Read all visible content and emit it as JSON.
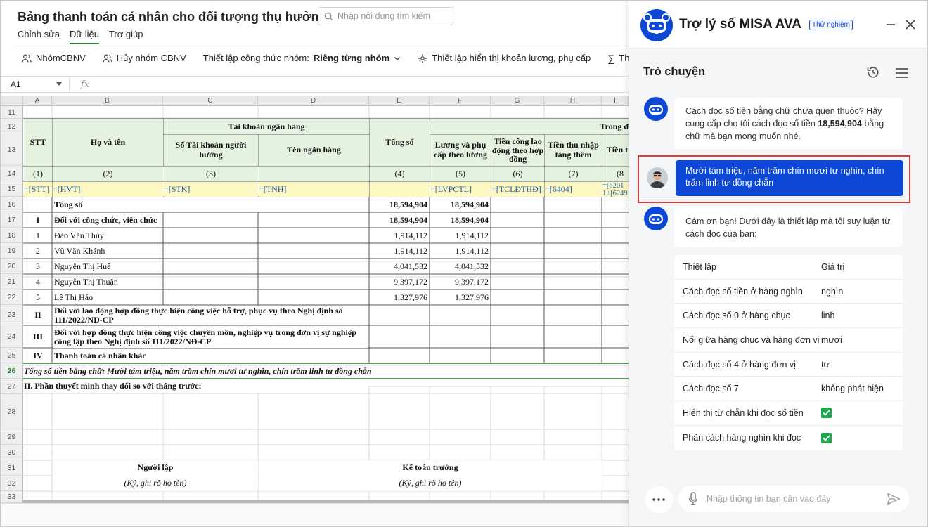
{
  "doc": {
    "title": "Bảng thanh toán cá nhân cho đối tượng thụ hưởng",
    "search_placeholder": "Nhập nội dung tìm kiếm",
    "menu": [
      "Chỉnh sửa",
      "Dữ liệu",
      "Trợ giúp"
    ],
    "toolbar": {
      "group": "NhómCBNV",
      "ungroup": "Hủy nhóm CBNV",
      "formula_label": "Thiết lập công thức nhóm:",
      "formula_value": "Riêng từng nhóm",
      "display": "Thiết lập hiển thị khoản lương, phụ cấp",
      "sum": "Thiết lập hi"
    },
    "cell_ref": "A1",
    "fx": "fx"
  },
  "sheet": {
    "col_letters": [
      "A",
      "B",
      "C",
      "D",
      "E",
      "F",
      "G",
      "H",
      "I"
    ],
    "row_numbers": [
      "11",
      "12",
      "13",
      "14",
      "15",
      "16",
      "17",
      "18",
      "19",
      "20",
      "21",
      "22",
      "23",
      "24",
      "25",
      "26",
      "27",
      "28",
      "29",
      "30",
      "31",
      "32",
      "33"
    ],
    "header": {
      "stt": "STT",
      "ho_ten": "Họ và tên",
      "bank": "Tài khoản ngân hàng",
      "so_tk": "Số Tài khoản người hưởng",
      "ten_nh": "Tên ngân hàng",
      "tong_so": "Tổng số",
      "luong": "Lương và phụ cấp theo lương",
      "tien_cong": "Tiền công lao động theo hợp đồng",
      "tien_thu": "Tiền thu nhập tăng thêm",
      "tien_t": "Tiền t",
      "trong": "Trong đ"
    },
    "index_row": [
      "(1)",
      "(2)",
      "(3)",
      "(4)",
      "(5)",
      "(6)",
      "(7)",
      "(8"
    ],
    "formula_row": [
      "=[STT]",
      "=[HVT]",
      "=[STK]",
      "=[TNH]",
      "=[LVPCTL]",
      "=[TCLĐTHĐ]",
      "=[6404]",
      "=[6201",
      "1+[6249"
    ],
    "total_label": "Tổng số",
    "total_e": "18,594,904",
    "total_f": "18,594,904",
    "sec1_no": "I",
    "sec1_label": "Đối với công chức, viên chức",
    "sec1_e": "18,594,904",
    "sec1_f": "18,594,904",
    "people": [
      {
        "stt": "1",
        "name": "Đào Văn Thủy",
        "e": "1,914,112",
        "f": "1,914,112"
      },
      {
        "stt": "2",
        "name": "Vũ Văn Khánh",
        "e": "1,914,112",
        "f": "1,914,112"
      },
      {
        "stt": "3",
        "name": "Nguyễn Thị Huế",
        "e": "4,041,532",
        "f": "4,041,532"
      },
      {
        "stt": "4",
        "name": "Nguyễn Thị Thuận",
        "e": "9,397,172",
        "f": "9,397,172"
      },
      {
        "stt": "5",
        "name": "Lê Thị Hảo",
        "e": "1,327,976",
        "f": "1,327,976"
      }
    ],
    "sec2_no": "II",
    "sec2_label": "Đối với lao động hợp đồng thực hiện công việc hỗ trợ, phục vụ theo Nghị định số 111/2022/NĐ-CP",
    "sec3_no": "III",
    "sec3_label": "Đối với hợp đồng thực hiện công việc chuyên môn, nghiệp vụ trong đơn vị sự nghiệp công lập theo Nghị định số 111/2022/NĐ-CP",
    "sec4_no": "IV",
    "sec4_label": "Thanh toán cá nhân khác",
    "words_row": "Tổng số tiền bằng chữ: Mười tám triệu, năm trăm chín mươi tư nghìn, chín trăm linh tư đồng chẵn",
    "part2": "II. Phần thuyết minh thay đổi so với tháng trước:",
    "nguoi_lap": "Người lập",
    "ke_toan": "Kế toán trưởng",
    "sign1": "(Ký, ghi rõ họ tên)",
    "sign2": "(Ký, ghi rõ họ tên)"
  },
  "assistant": {
    "title": "Trợ lý số MISA AVA",
    "badge": "Thử nghiệm",
    "chat_title": "Trò chuyện",
    "bot_msg1_a": "Cách đọc số tiền bằng chữ chưa quen thuộc? Hãy cung cấp cho tôi cách đọc số tiền ",
    "bot_msg1_amount": "18,594,904",
    "bot_msg1_b": " bằng chữ mà bạn mong muốn nhé.",
    "user_msg": "Mười tám triệu, năm trăm chín mươi tư nghìn, chín trăm linh tư đồng chẵn",
    "bot_msg2": "Cám ơn bạn! Dưới đây là thiết lập mà tôi suy luận từ cách đọc của bạn:",
    "table_head": [
      "Thiết lập",
      "Giá trị"
    ],
    "settings": [
      {
        "label": "Cách đọc số tiền ở hàng nghìn",
        "value": "nghìn"
      },
      {
        "label": "Cách đọc số 0 ở hàng chục",
        "value": "linh"
      },
      {
        "label": "Nối giữa hàng chục và hàng đơn vị",
        "value": "mươi"
      },
      {
        "label": "Cách đọc số 4 ở hàng đơn vị",
        "value": "tư"
      },
      {
        "label": "Cách đọc số 7",
        "value": "không phát hiện"
      },
      {
        "label": "Hiển thị từ chẵn khi đọc số tiền",
        "value": ""
      },
      {
        "label": "Phân cách hàng nghìn khi đọc",
        "value": ""
      }
    ],
    "input_placeholder": "Nhập thông tin bạn cần vào đây"
  },
  "colors": {
    "accent_blue": "#0d47d6",
    "green": "#1ea94f",
    "highlight_red": "#e53935",
    "header_green": "#e4f2e0",
    "formula_yellow": "#fdf7c2"
  }
}
